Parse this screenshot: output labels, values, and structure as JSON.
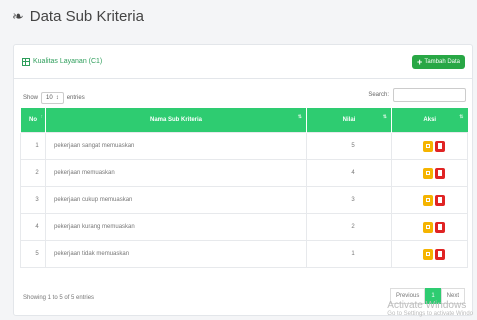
{
  "header": {
    "title": "Data Sub Kriteria",
    "icon": "users-icon"
  },
  "card": {
    "title": "Kualitas Layanan (C1)",
    "add_button": "Tambah Data"
  },
  "controls": {
    "show_label": "Show",
    "entries_value": "10",
    "entries_label": "entries",
    "search_label": "Search:"
  },
  "table": {
    "columns": [
      "No",
      "Nama Sub Kriteria",
      "Nilai",
      "Aksi"
    ],
    "rows": [
      {
        "no": "1",
        "name": "pekerjaan sangat memuaskan",
        "nilai": "5"
      },
      {
        "no": "2",
        "name": "pekerjaan memuaskan",
        "nilai": "4"
      },
      {
        "no": "3",
        "name": "pekerjaan cukup memuaskan",
        "nilai": "3"
      },
      {
        "no": "4",
        "name": "pekerjaan kurang memuaskan",
        "nilai": "2"
      },
      {
        "no": "5",
        "name": "pekerjaan tidak memuaskan",
        "nilai": "1"
      }
    ]
  },
  "footer": {
    "info": "Showing 1 to 5 of 5 entries",
    "prev": "Previous",
    "page": "1",
    "next": "Next"
  },
  "watermark": {
    "line1": "Activate Windows",
    "line2": "Go to Settings to activate Windo"
  },
  "colors": {
    "primary": "#2ecc71",
    "edit": "#f5b400",
    "delete": "#e02424"
  }
}
